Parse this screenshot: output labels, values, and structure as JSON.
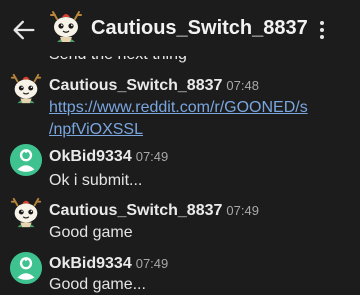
{
  "header": {
    "title": "Cautious_Switch_8837"
  },
  "clipped_message": "Send the next thing",
  "messages": [
    {
      "user": "Cautious_Switch_8837",
      "time": "07:48",
      "link_line1": "https://www.reddit.com/r/GOONED/s",
      "link_line2": "/npfViOXSSL"
    },
    {
      "user": "OkBid9334",
      "time": "07:49",
      "text": "Ok i submit..."
    },
    {
      "user": "Cautious_Switch_8837",
      "time": "07:49",
      "text": "Good game"
    },
    {
      "user": "OkBid9334",
      "time": "07:49",
      "text": "Good game..."
    }
  ],
  "icons": {
    "back": "arrow-left-icon",
    "more": "more-vertical-icon",
    "cautious_avatar": "snoo-creature-avatar",
    "okbid_avatar": "green-snoo-avatar"
  },
  "colors": {
    "background": "#1c1c1c",
    "link": "#7aa6e0",
    "okbid_avatar_bg": "#3ec28f",
    "cautious_avatar_bg": "#f7f3e8"
  }
}
